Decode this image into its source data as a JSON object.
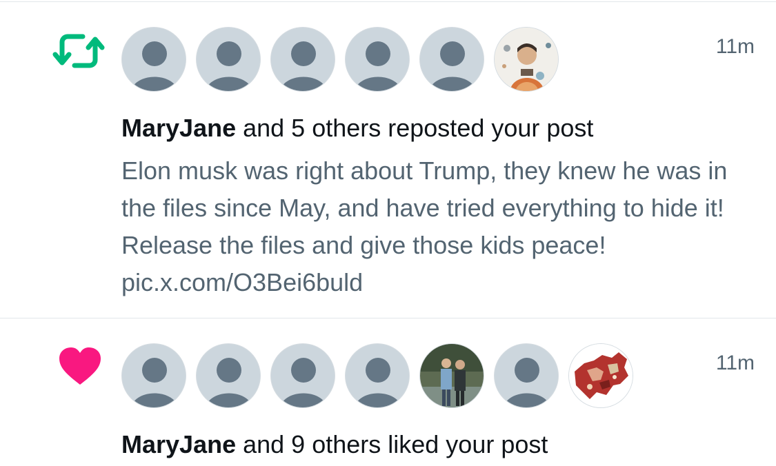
{
  "notifications": [
    {
      "type": "repost",
      "icon": "repost-icon",
      "icon_color": "#00ba7c",
      "time": "11m",
      "name": "MaryJane",
      "summary_rest": " and 5 others reposted your post",
      "preview": "Elon musk was right about Trump, they knew he was in the files since May, and have tried everything to hide it! Release the files and give those kids peace! pic.x.com/O3Bei6buld"
    },
    {
      "type": "like",
      "icon": "heart-icon",
      "icon_color": "#f91880",
      "time": "11m",
      "name": "MaryJane",
      "summary_rest": " and 9 others liked your post"
    }
  ],
  "colors": {
    "default_avatar_bg": "#ccd6dd",
    "default_avatar_fg": "#657786",
    "secondary_text": "#536471",
    "divider": "#e1e6ea"
  }
}
